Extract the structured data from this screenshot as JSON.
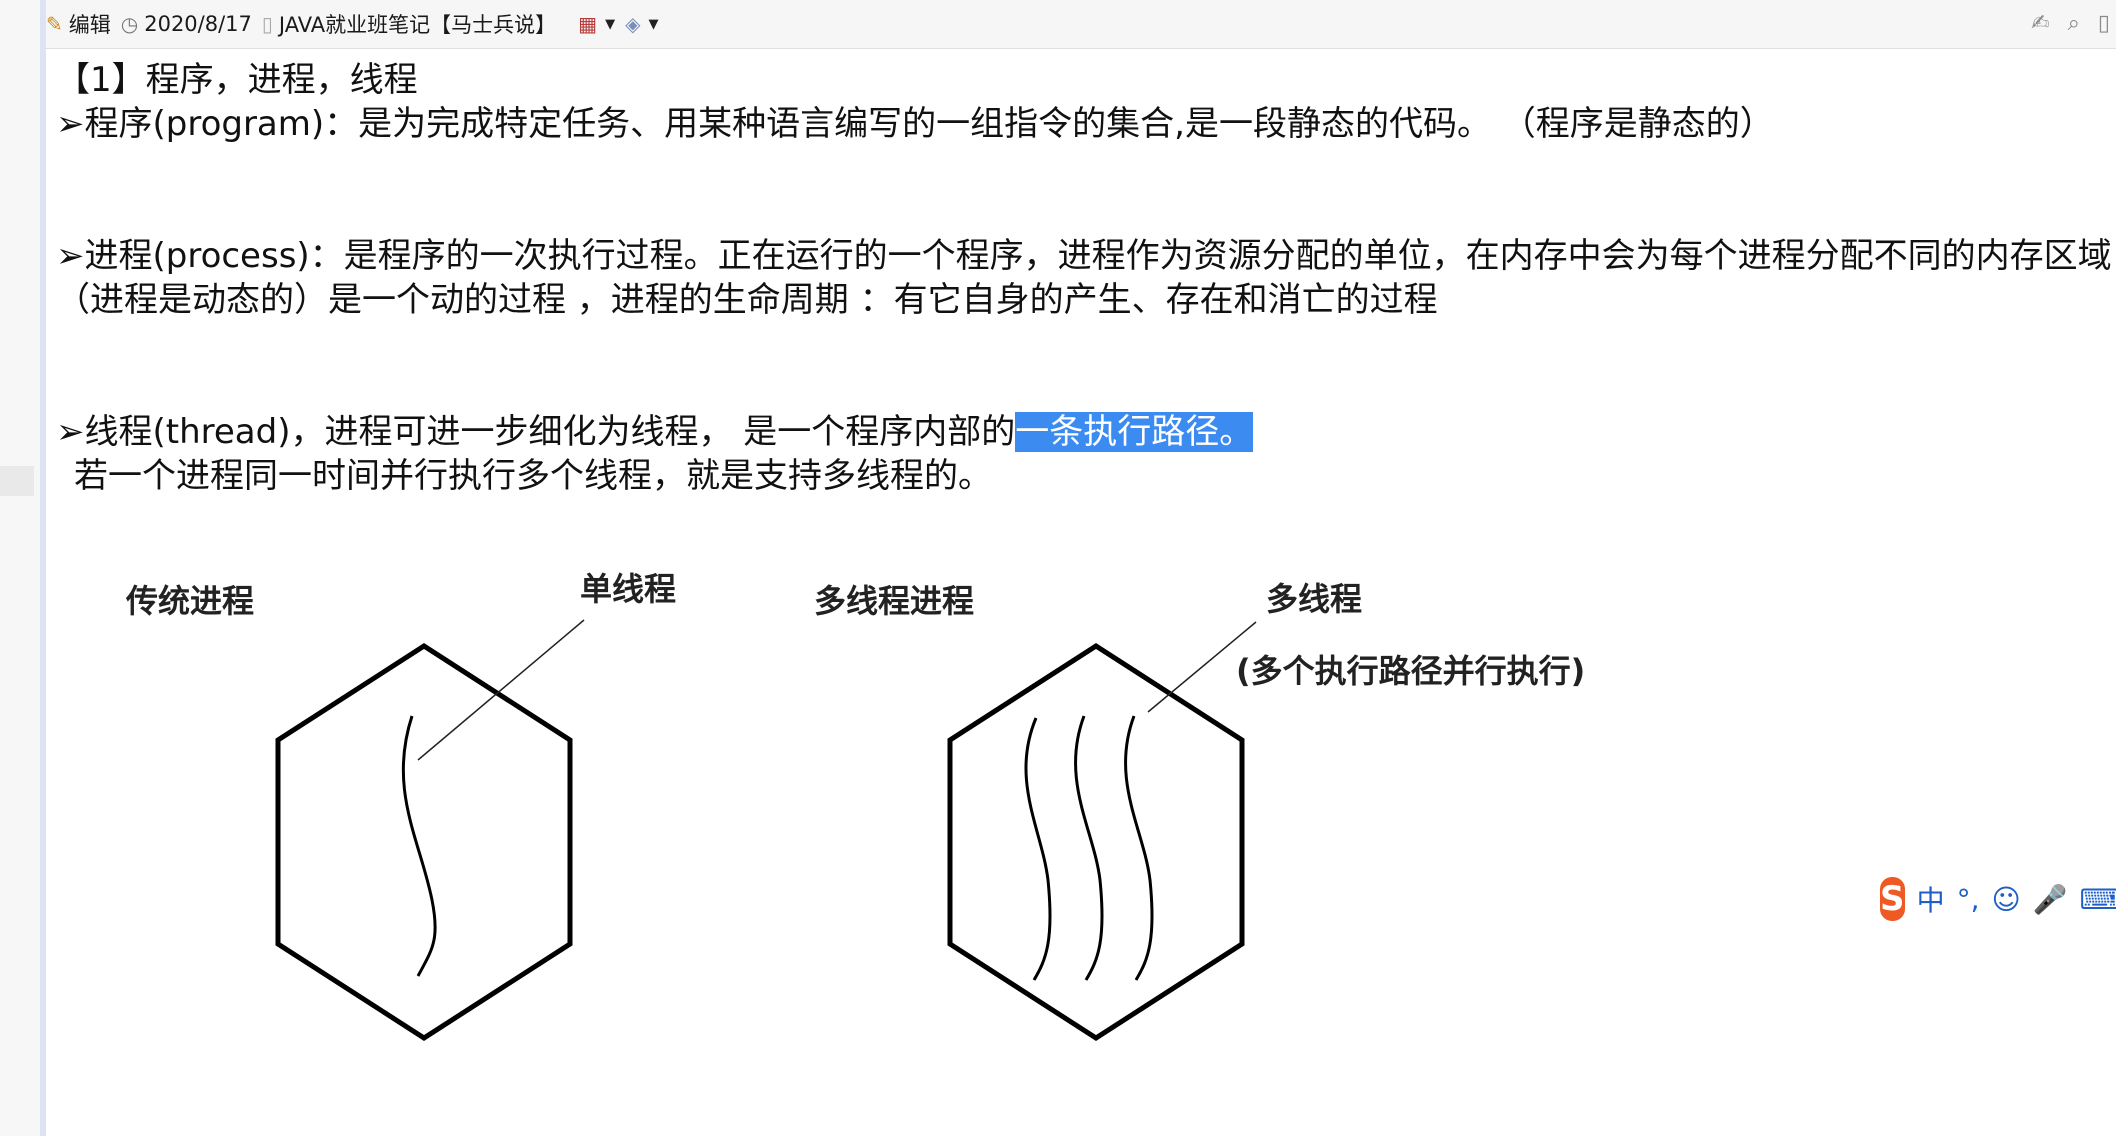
{
  "toolbar": {
    "edit_label": "编辑",
    "date": "2020/8/17",
    "notebook": "JAVA就业班笔记【马士兵说】"
  },
  "icons": {
    "edit": "pencil-icon",
    "date": "clock-icon",
    "notebook": "notebook-icon",
    "calendar": "calendar-icon",
    "tag": "tag-icon",
    "right_edit": "edit-note-icon",
    "right_search": "search-note-icon"
  },
  "note": {
    "heading": "【1】程序，进程，线程",
    "program": "➢程序(program)：是为完成特定任务、用某种语言编写的一组指令的集合,是一段静态的代码。  （程序是静态的）",
    "process_line1": "➢进程(process)：是程序的一次执行过程。正在运行的一个程序，进程作为资源分配的单位，在内存中会为每个进程分配不同的内存区域",
    "process_line2": "（进程是动态的）是一个动的过程 ，进程的生命周期 ：有它自身的产生、存在和消亡的过程",
    "thread_line1_plain": "➢线程(thread)，进程可进一步细化为线程， 是一个程序内部的",
    "thread_line1_selected": "一条执行路径。",
    "thread_line2": "若一个进程同一时间并行执行多个线程，就是支持多线程的。"
  },
  "diagram": {
    "label_traditional": "传统进程",
    "label_single_thread": "单线程",
    "label_multi_process": "多线程进程",
    "label_multi_thread": "多线程",
    "label_multi_desc": "(多个执行路径并行执行)"
  },
  "ime": {
    "logo": "S",
    "mode": "中",
    "punct": "°,"
  },
  "colors": {
    "selection": "#3b8bf0",
    "ime_logo": "#ef5a24",
    "ime_text": "#1d5fc7"
  }
}
